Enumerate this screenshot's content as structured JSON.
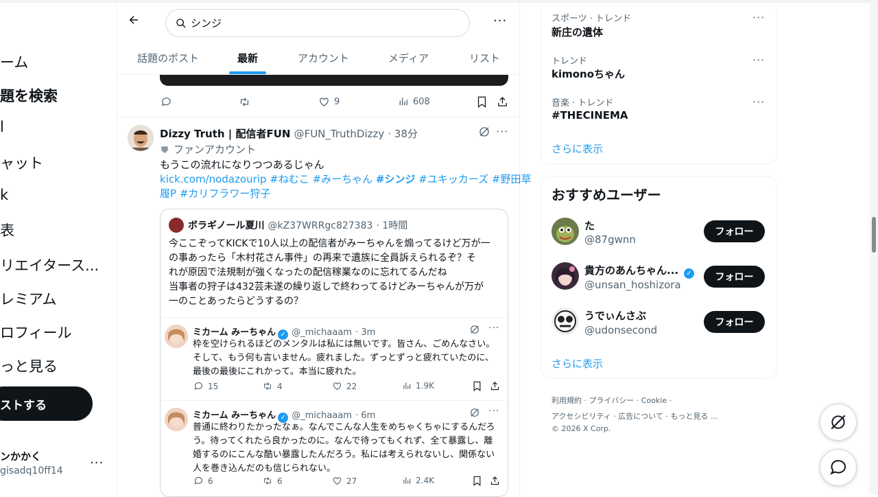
{
  "search": {
    "value": "シンジ"
  },
  "tabs": [
    "話題のポスト",
    "最新",
    "アカウント",
    "メディア",
    "リスト"
  ],
  "nav": {
    "items": [
      "ーム",
      "題を検索",
      "l",
      "ャット",
      "k",
      "表",
      "リエイタース...",
      "レミアム",
      "ロフィール",
      "っと見る"
    ],
    "post_button": "ストする",
    "account_name": "ンかかく",
    "account_handle": "gisadq10ff14"
  },
  "prev_post_actions": {
    "likes": "9",
    "views": "608"
  },
  "post": {
    "author": "Dizzy Truth | 配信者FUN",
    "handle": "@FUN_TruthDizzy",
    "time": "· 38分",
    "badge": "ファンアカウント",
    "text": "もうこの流れになりつつあるじゃん",
    "link": "kick.com/nodazourip",
    "tags_line1": "#ねむこ #みーちゃん",
    "tag_bold": "#シンジ",
    "tags_line1b": "#ユキッカーズ #野田草",
    "tags_line2": "履P #カリフラワー狩子",
    "quote": {
      "author": "ボラギノール夏川",
      "handle": "@kZ37WRRgc827383",
      "time": "· 1時間",
      "lines": [
        "今ここぞってKICKで10人以上の配信者がみーちゃんを煽ってるけど万が一",
        "の事あったら「木村花さん事件」の再来で遺族に全員訴えられるぞ？そ",
        "れが原因で法規制が強くなったの配信稼業なのに忘れてるんだね",
        "当事者の狩子は432芸未遂の繰り返しで終わってるけどみーちゃんが万が",
        "一のことあったらどうするの？"
      ]
    },
    "replies": [
      {
        "author": "ミカーム みーちゃん",
        "handle": "@_michaaam",
        "time": "· 3m",
        "lines": [
          "枠を空けられるほどのメンタルは私には無いです。皆さん、ごめんなさい。",
          "そして、もう何も言いません。疲れました。ずっとずっと疲れていたのに、",
          "最後の最後にこれかって。本当に疲れた。"
        ],
        "replies": "15",
        "reposts": "4",
        "likes": "22",
        "views": "1.9K"
      },
      {
        "author": "ミカーム みーちゃん",
        "handle": "@_michaaam",
        "time": "· 6m",
        "lines": [
          "普通に終わりたかったなぁ。なんでこんな人生をめちゃくちゃにするんだろ",
          "う。待ってくれたら良かったのに。なんで待ってもくれず、全て暴露し、離",
          "婚するのにこんな酷い暴露したんだろう。私には考えられないし、関係ない",
          "人を巻き込んだのも信じられない。"
        ],
        "replies": "6",
        "reposts": "6",
        "likes": "27",
        "views": "2.4K"
      }
    ]
  },
  "trends": [
    {
      "category": "スポーツ · トレンド",
      "name": "新庄の遺体"
    },
    {
      "category": "トレンド",
      "name": "kimonoちゃん"
    },
    {
      "category": "音楽 · トレンド",
      "name": "#THECINEMA"
    }
  ],
  "trends_show_more": "さらに表示",
  "who_to_follow": {
    "title": "おすすめユーザー",
    "users": [
      {
        "name": "た",
        "handle": "@87gwnn",
        "button": "フォロー"
      },
      {
        "name": "貴方のあんちゃん...",
        "handle": "@unsan_hoshizora",
        "button": "フォロー"
      },
      {
        "name": "うでぃんさぶ",
        "handle": "@udonsecond",
        "button": "フォロー"
      }
    ],
    "show_more": "さらに表示"
  },
  "footer": {
    "line1": [
      "利用規約",
      "プライバシー",
      "Cookie"
    ],
    "line2": [
      "アクセシビリティ",
      "広告について",
      "もっと見る …"
    ],
    "copyright": "© 2026 X Corp."
  },
  "colors": {
    "accent": "#1d9bf0",
    "text": "#0f1419",
    "muted": "#536471",
    "border": "#eff3f4"
  },
  "icons": [
    "back-arrow-icon",
    "search-icon",
    "more-icon",
    "reply-icon",
    "repost-icon",
    "like-icon",
    "views-icon",
    "bookmark-icon",
    "share-icon",
    "grok-icon",
    "verified-icon",
    "messages-icon"
  ]
}
